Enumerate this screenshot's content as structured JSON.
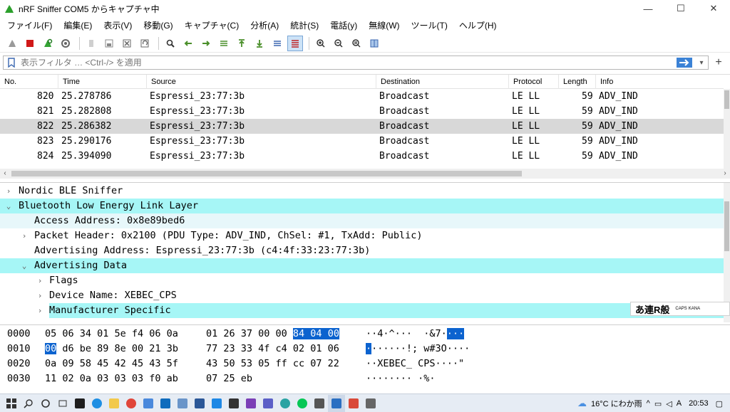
{
  "window": {
    "title": "nRF Sniffer COM5 からキャプチャ中",
    "controls": [
      "—",
      "☐",
      "✕"
    ]
  },
  "menu": [
    "ファイル(F)",
    "編集(E)",
    "表示(V)",
    "移動(G)",
    "キャプチャ(C)",
    "分析(A)",
    "統計(S)",
    "電話(y)",
    "無線(W)",
    "ツール(T)",
    "ヘルプ(H)"
  ],
  "filter": {
    "placeholder": "表示フィルタ … <Ctrl-/> を適用",
    "apply_icon": "arrow-right-icon",
    "plus": "+"
  },
  "packet_list": {
    "columns": [
      "No.",
      "Time",
      "Source",
      "Destination",
      "Protocol",
      "Length",
      "Info"
    ],
    "rows": [
      {
        "no": "820",
        "time": "25.278786",
        "source": "Espressi_23:77:3b",
        "destination": "Broadcast",
        "protocol": "LE LL",
        "length": "59",
        "info": "ADV_IND"
      },
      {
        "no": "821",
        "time": "25.282808",
        "source": "Espressi_23:77:3b",
        "destination": "Broadcast",
        "protocol": "LE LL",
        "length": "59",
        "info": "ADV_IND"
      },
      {
        "no": "822",
        "time": "25.286382",
        "source": "Espressi_23:77:3b",
        "destination": "Broadcast",
        "protocol": "LE LL",
        "length": "59",
        "info": "ADV_IND"
      },
      {
        "no": "823",
        "time": "25.290176",
        "source": "Espressi_23:77:3b",
        "destination": "Broadcast",
        "protocol": "LE LL",
        "length": "59",
        "info": "ADV_IND"
      },
      {
        "no": "824",
        "time": "25.394090",
        "source": "Espressi_23:77:3b",
        "destination": "Broadcast",
        "protocol": "LE LL",
        "length": "59",
        "info": "ADV_IND"
      }
    ],
    "selected_row": "822"
  },
  "detail_tree": [
    {
      "text": "Nordic BLE Sniffer",
      "arrow": "›"
    },
    {
      "text": "Bluetooth Low Energy Link Layer",
      "arrow": "⌄"
    },
    {
      "text": "Access Address: 0x8e89bed6",
      "arrow": ""
    },
    {
      "text": "Packet Header: 0x2100 (PDU Type: ADV_IND, ChSel: #1, TxAdd: Public)",
      "arrow": "›"
    },
    {
      "text": "Advertising Address: Espressi_23:77:3b (c4:4f:33:23:77:3b)",
      "arrow": ""
    },
    {
      "text": "Advertising Data",
      "arrow": "⌄"
    },
    {
      "text": "Flags",
      "arrow": "›"
    },
    {
      "text": "Device Name: XEBEC_CPS",
      "arrow": "›"
    },
    {
      "text": "Manufacturer Specific",
      "arrow": "›"
    }
  ],
  "ime": {
    "text": "あ連R般",
    "caps": "CAPS",
    "kana": "KANA"
  },
  "hex_dump": [
    {
      "offset": "0000",
      "b1": "05 06 34 01 5e f4 06 0a",
      "b2a": "01 26 37 00 00 ",
      "b2sel": "84 04 00",
      "asc_a": "··4·^···  ·&7·",
      "asc_sel": "···"
    },
    {
      "offset": "0010",
      "b1sel": "00",
      "b1": " d6 be 89 8e 00 21 3b",
      "b2": "77 23 33 4f c4 02 01 06",
      "asc_sel": "·",
      "asc_a": "······!; w#3O····"
    },
    {
      "offset": "0020",
      "b1": "0a 09 58 45 42 45 43 5f",
      "b2": "43 50 53 05 ff cc 07 22",
      "asc_a": "··XEBEC_ CPS····\""
    },
    {
      "offset": "0030",
      "b1": "11 02 0a 03 03 03 f0 ab",
      "b2": "07 25 eb",
      "asc_a": "········ ·%·"
    }
  ],
  "taskbar": {
    "weather": "16°C にわか雨",
    "clock": "20:53"
  }
}
